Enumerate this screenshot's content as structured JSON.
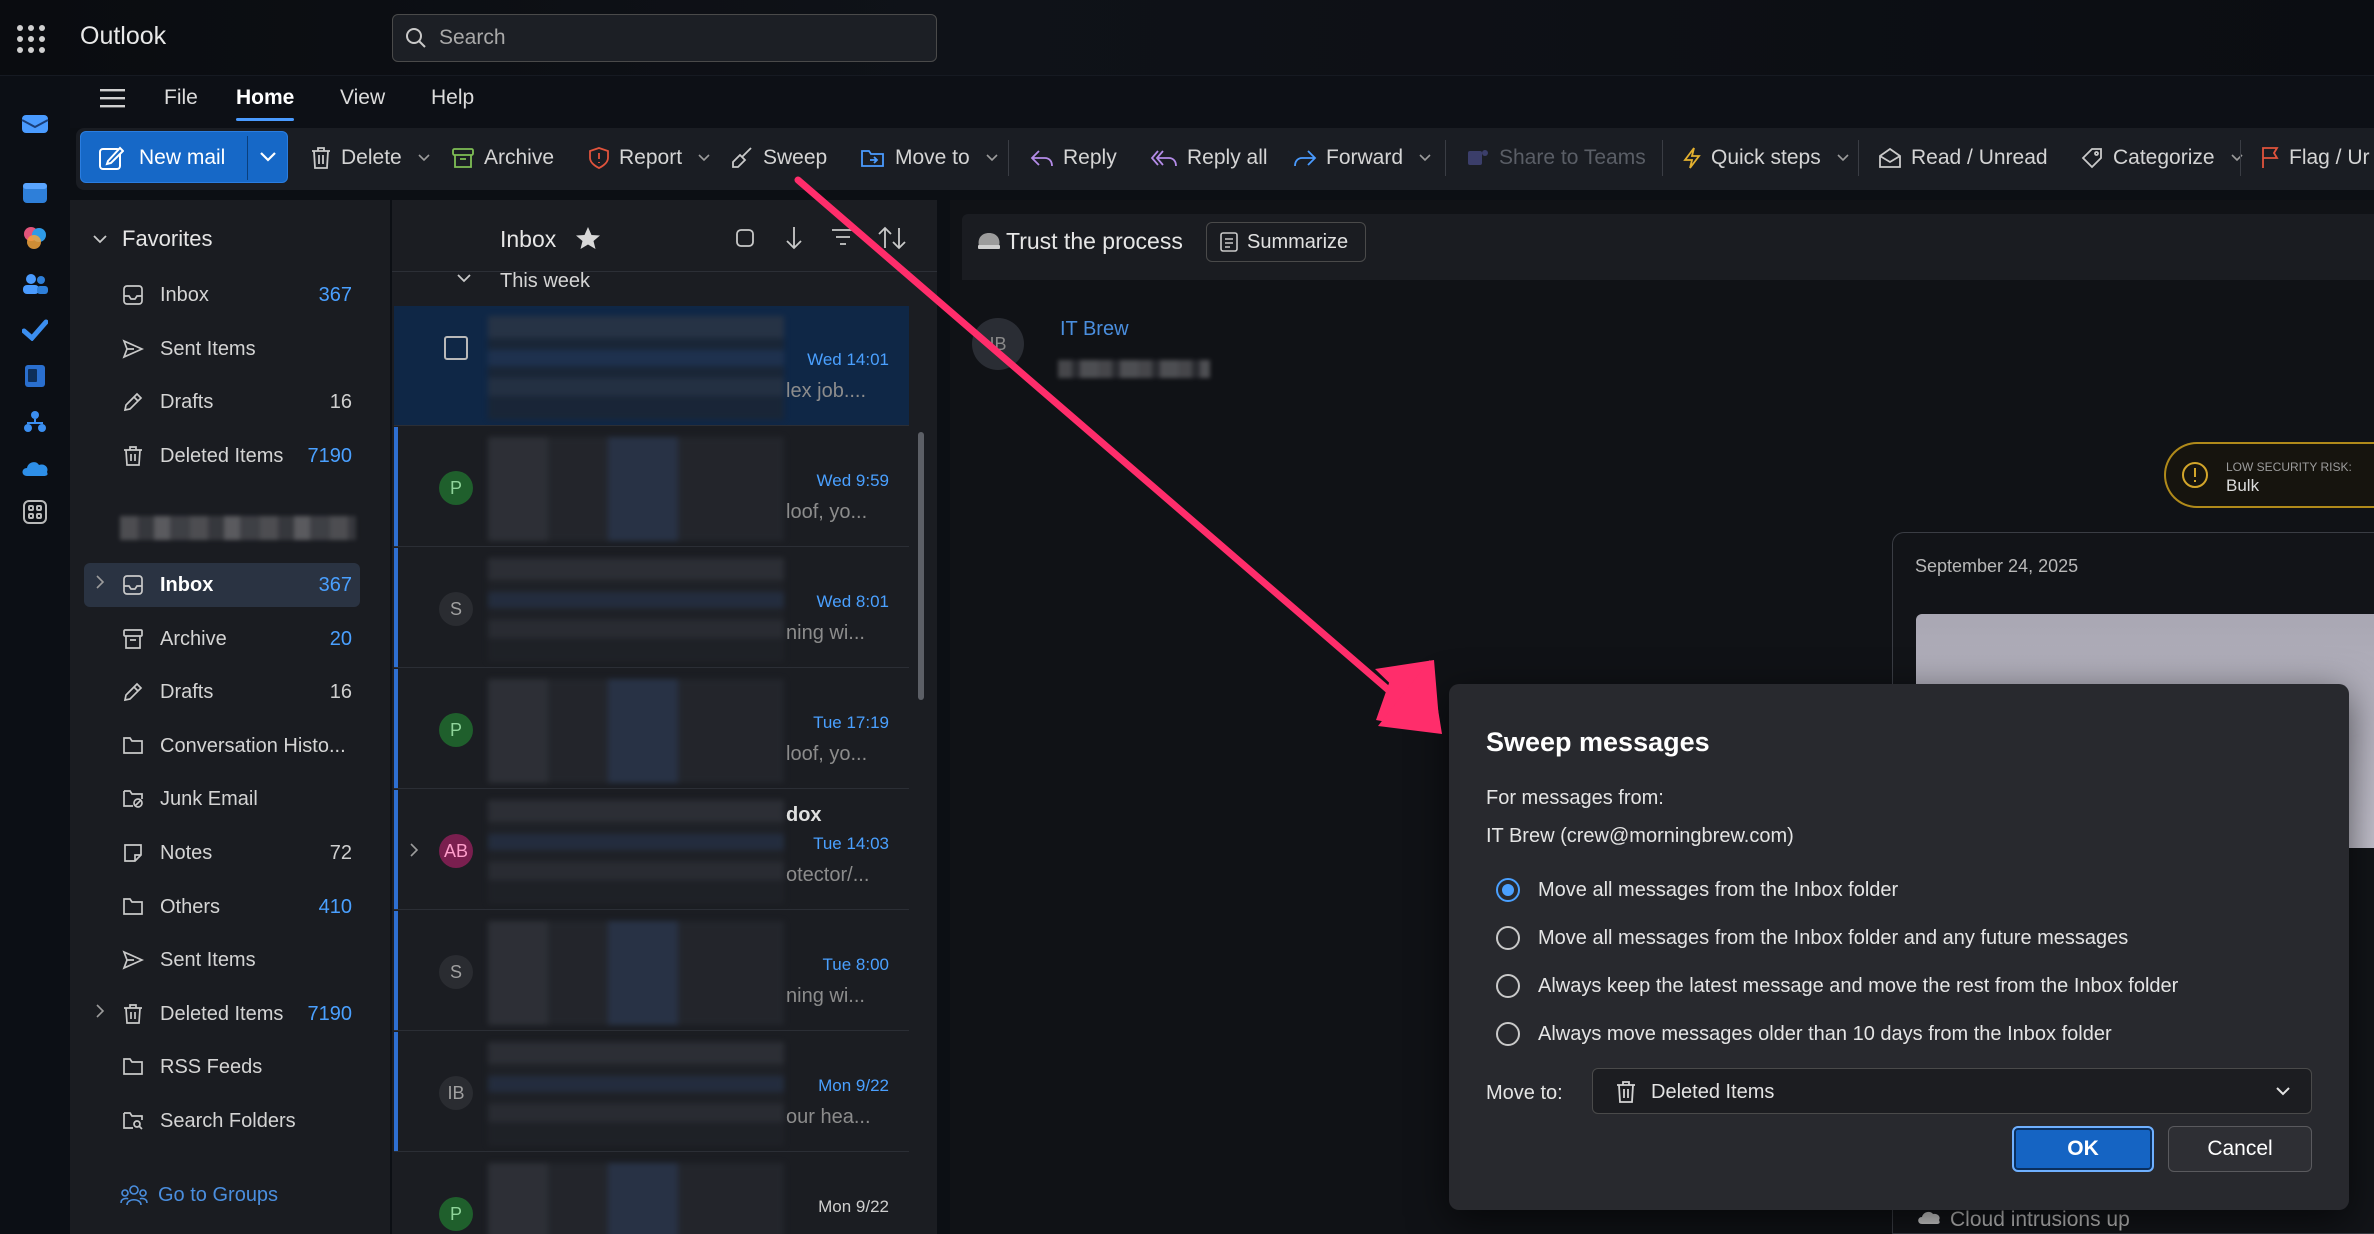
{
  "app": {
    "title": "Outlook"
  },
  "search": {
    "placeholder": "Search"
  },
  "menu_tabs": [
    {
      "label": "File",
      "active": false
    },
    {
      "label": "Home",
      "active": true
    },
    {
      "label": "View",
      "active": false
    },
    {
      "label": "Help",
      "active": false
    }
  ],
  "ribbon": {
    "new_mail": "New mail",
    "delete": "Delete",
    "archive": "Archive",
    "report": "Report",
    "sweep": "Sweep",
    "move_to": "Move to",
    "reply": "Reply",
    "reply_all": "Reply all",
    "forward": "Forward",
    "share_to_teams": "Share to Teams",
    "quick_steps": "Quick steps",
    "read_unread": "Read / Unread",
    "categorize": "Categorize",
    "flag": "Flag / Ur"
  },
  "folders": {
    "favorites_label": "Favorites",
    "favorites": [
      {
        "label": "Inbox",
        "count": "367",
        "icon": "inbox-icon"
      },
      {
        "label": "Sent Items",
        "count": "",
        "icon": "send-icon"
      },
      {
        "label": "Drafts",
        "count": "16",
        "icon": "pencil-icon"
      },
      {
        "label": "Deleted Items",
        "count": "7190",
        "icon": "trash-icon"
      }
    ],
    "mailbox": [
      {
        "label": "Inbox",
        "count": "367",
        "icon": "inbox-icon"
      },
      {
        "label": "Archive",
        "count": "20",
        "icon": "archive-icon"
      },
      {
        "label": "Drafts",
        "count": "16",
        "icon": "pencil-icon"
      },
      {
        "label": "Conversation Histo...",
        "count": "",
        "icon": "folder-icon"
      },
      {
        "label": "Junk Email",
        "count": "",
        "icon": "junk-icon"
      },
      {
        "label": "Notes",
        "count": "72",
        "icon": "note-icon"
      },
      {
        "label": "Others",
        "count": "410",
        "icon": "folder-icon"
      },
      {
        "label": "Sent Items",
        "count": "",
        "icon": "send-icon"
      },
      {
        "label": "Deleted Items",
        "count": "7190",
        "icon": "trash-icon"
      },
      {
        "label": "RSS Feeds",
        "count": "",
        "icon": "folder-icon"
      },
      {
        "label": "Search Folders",
        "count": "",
        "icon": "search-folder-icon"
      }
    ],
    "go_to_groups": "Go to Groups"
  },
  "message_list": {
    "title": "Inbox",
    "group": "This week",
    "messages": [
      {
        "avatar": "",
        "date": "Wed 14:01",
        "preview": "lex job....",
        "subject": "",
        "avatar_color": "",
        "selected": true
      },
      {
        "avatar": "P",
        "date": "Wed 9:59",
        "preview": "loof, yo...",
        "subject": "",
        "avatar_color": "#1f5f2c",
        "selected": false
      },
      {
        "avatar": "S",
        "date": "Wed 8:01",
        "preview": "ning wi...",
        "subject": "",
        "avatar_color": "#2a2c31",
        "selected": false
      },
      {
        "avatar": "P",
        "date": "Tue 17:19",
        "preview": "loof, yo...",
        "subject": "",
        "avatar_color": "#1f5f2c",
        "selected": false
      },
      {
        "avatar": "AB",
        "date": "Tue 14:03",
        "preview": "otector/...",
        "subject": "dox",
        "avatar_color": "#7a1f4f",
        "selected": false
      },
      {
        "avatar": "S",
        "date": "Tue 8:00",
        "preview": "ning wi...",
        "subject": "",
        "avatar_color": "#2a2c31",
        "selected": false
      },
      {
        "avatar": "IB",
        "date": "Mon 9/22",
        "preview": "our hea...",
        "subject": "",
        "avatar_color": "#2a2c31",
        "selected": false
      },
      {
        "avatar": "P",
        "date": "Mon 9/22",
        "preview": "",
        "subject": "",
        "avatar_color": "#1f5f2c",
        "selected": false
      }
    ]
  },
  "reading": {
    "subject": "Trust the process",
    "summarize": "Summarize",
    "sender_initials": "IB",
    "sender_name": "IT Brew",
    "risk_label": "LOW SECURITY RISK:",
    "risk_value": "Bulk",
    "card_date": "September 24, 2025",
    "card_footer": "Cloud intrusions up"
  },
  "dialog": {
    "title": "Sweep messages",
    "from_label": "For messages from:",
    "sender": "IT Brew (crew@morningbrew.com)",
    "options": [
      {
        "label": "Move all messages from the Inbox folder",
        "selected": true
      },
      {
        "label": "Move all messages from the Inbox folder and any future messages",
        "selected": false
      },
      {
        "label": "Always keep the latest message and move the rest from the Inbox folder",
        "selected": false
      },
      {
        "label": "Always move messages older than 10 days from the Inbox folder",
        "selected": false
      }
    ],
    "move_to_label": "Move to:",
    "move_to_value": "Deleted Items",
    "ok": "OK",
    "cancel": "Cancel"
  },
  "colors": {
    "accent": "#1668c7",
    "annotation_arrow": "#ff2d6b",
    "unread_date": "#4aa0ff"
  }
}
